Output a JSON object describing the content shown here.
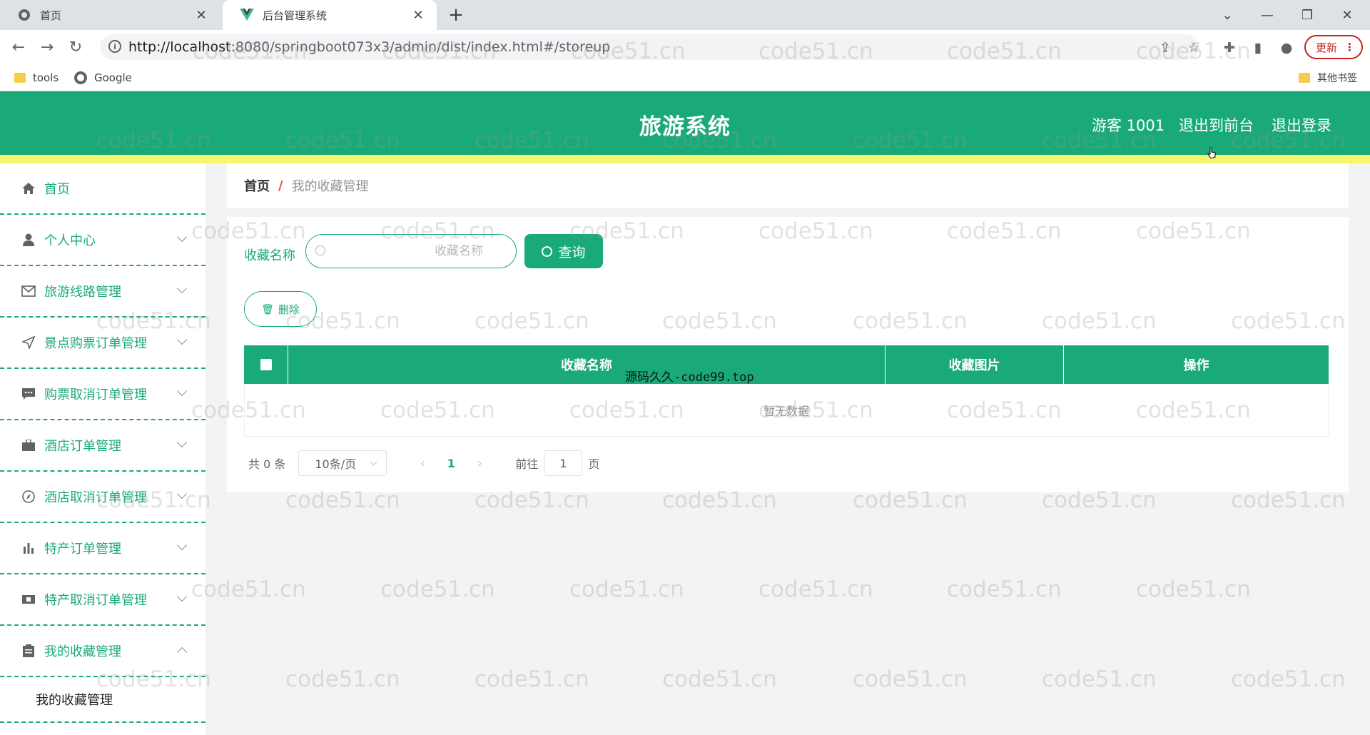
{
  "browser": {
    "tabs": [
      {
        "title": "首页",
        "active": false
      },
      {
        "title": "后台管理系统",
        "active": true
      }
    ],
    "url_host": "http://localhost",
    "url_path": ":8080/springboot073x3/admin/dist/index.html#/storeup",
    "update_label": "更新",
    "bookmarks": [
      {
        "label": "tools"
      },
      {
        "label": "Google"
      }
    ],
    "other_bookmarks": "其他书签"
  },
  "header": {
    "brand": "旅游系统",
    "user": "游客 1001",
    "back_to_front": "退出到前台",
    "logout": "退出登录"
  },
  "sidebar": {
    "items": [
      {
        "label": "首页"
      },
      {
        "label": "个人中心"
      },
      {
        "label": "旅游线路管理"
      },
      {
        "label": "景点购票订单管理"
      },
      {
        "label": "购票取消订单管理"
      },
      {
        "label": "酒店订单管理"
      },
      {
        "label": "酒店取消订单管理"
      },
      {
        "label": "特产订单管理"
      },
      {
        "label": "特产取消订单管理"
      },
      {
        "label": "我的收藏管理"
      }
    ],
    "submenu": {
      "label": "我的收藏管理"
    }
  },
  "breadcrumb": {
    "home": "首页",
    "separator": "/",
    "current": "我的收藏管理"
  },
  "search": {
    "label": "收藏名称",
    "placeholder": "收藏名称",
    "button": "查询"
  },
  "toolbar": {
    "delete_label": "删除"
  },
  "table": {
    "columns": [
      "收藏名称",
      "收藏图片",
      "操作"
    ],
    "empty_text": "暂无数据"
  },
  "pagination": {
    "total": "共 0 条",
    "page_size": "10条/页",
    "current_page": "1",
    "goto_prefix": "前往",
    "goto_value": "1",
    "goto_suffix": "页"
  },
  "overlay": "源码久久-code99.top",
  "watermark": "code51.cn",
  "colors": {
    "primary": "#1aaa78",
    "strip": "#f6f66b"
  }
}
